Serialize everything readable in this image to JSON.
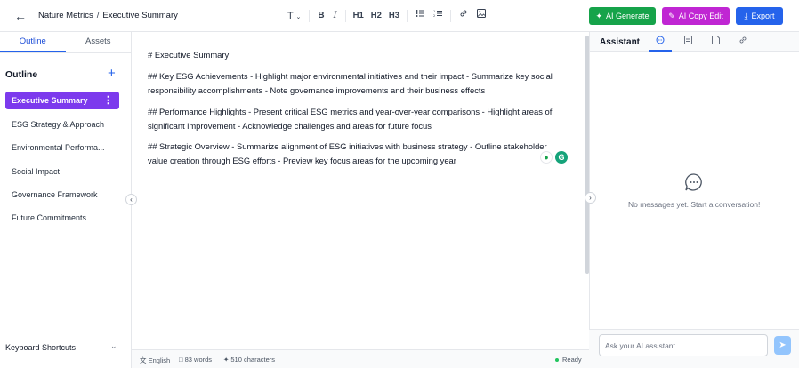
{
  "header": {
    "back_icon": "arrow-left-icon",
    "project": "Nature Metrics",
    "separator": "/",
    "document": "Executive Summary"
  },
  "toolbar": {
    "text_style": "T",
    "bold": "B",
    "italic": "I",
    "h1": "H1",
    "h2": "H2",
    "h3": "H3",
    "icons": [
      "font-type-icon",
      "bullet-list-icon",
      "numbered-list-icon",
      "link-icon",
      "image-icon"
    ]
  },
  "actions": {
    "ai_generate": "AI Generate",
    "ai_copy_edit": "AI Copy Edit",
    "export": "Export",
    "colors": {
      "generate": "#16a34a",
      "copy_edit": "#c026d3",
      "export": "#2563eb"
    }
  },
  "sidebar": {
    "tabs": [
      "Outline",
      "Assets"
    ],
    "active_tab": "Outline",
    "heading": "Outline",
    "add_icon": "plus-icon",
    "items": [
      {
        "label": "Executive Summary",
        "active": true
      },
      {
        "label": "ESG Strategy & Approach",
        "active": false
      },
      {
        "label": "Environmental Performa...",
        "active": false
      },
      {
        "label": "Social Impact",
        "active": false
      },
      {
        "label": "Governance Framework",
        "active": false
      },
      {
        "label": "Future Commitments",
        "active": false
      }
    ],
    "footer": "Keyboard Shortcuts",
    "accent": "#7c3aed"
  },
  "editor": {
    "paragraphs": [
      "# Executive Summary",
      "## Key ESG Achievements - Highlight major environmental initiatives and their impact - Summarize key social responsibility accomplishments - Note governance improvements and their business effects",
      "## Performance Highlights - Present critical ESG metrics and year-over-year comparisons - Highlight areas of significant improvement - Acknowledge challenges and areas for future focus",
      "## Strategic Overview - Summarize alignment of ESG initiatives with business strategy - Outline stakeholder value creation through ESG efforts - Preview key focus areas for the upcoming year"
    ]
  },
  "status": {
    "language": "English",
    "words": "83 words",
    "characters": "510 characters",
    "state": "Ready"
  },
  "assistant": {
    "title": "Assistant",
    "tabs": [
      "chat-icon",
      "document-icon",
      "file-icon",
      "link-icon"
    ],
    "empty_message": "No messages yet. Start a conversation!",
    "input_placeholder": "Ask your AI assistant...",
    "send_icon": "send-icon"
  }
}
